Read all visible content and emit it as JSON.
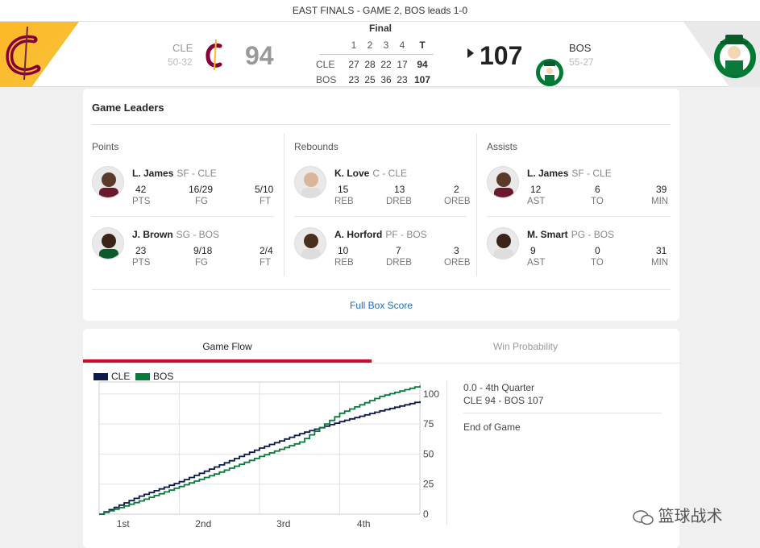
{
  "series_text": "EAST FINALS - GAME 2, BOS leads 1-0",
  "away": {
    "abbr": "CLE",
    "record": "50-32",
    "score": "94",
    "color": "#860038"
  },
  "home": {
    "abbr": "BOS",
    "record": "55-27",
    "score": "107",
    "color": "#007a33"
  },
  "linescore": {
    "status": "Final",
    "headers": [
      "1",
      "2",
      "3",
      "4",
      "T"
    ],
    "rows": [
      {
        "team": "CLE",
        "q": [
          "27",
          "28",
          "22",
          "17"
        ],
        "total": "94"
      },
      {
        "team": "BOS",
        "q": [
          "23",
          "25",
          "36",
          "23"
        ],
        "total": "107"
      }
    ]
  },
  "leaders": {
    "title": "Game Leaders",
    "columns": [
      {
        "title": "Points",
        "players": [
          {
            "name": "L. James",
            "pos": "SF - CLE",
            "stats": [
              "42",
              "16/29",
              "5/10"
            ],
            "labels": [
              "PTS",
              "FG",
              "FT"
            ]
          },
          {
            "name": "J. Brown",
            "pos": "SG - BOS",
            "stats": [
              "23",
              "9/18",
              "2/4"
            ],
            "labels": [
              "PTS",
              "FG",
              "FT"
            ]
          }
        ]
      },
      {
        "title": "Rebounds",
        "players": [
          {
            "name": "K. Love",
            "pos": "C - CLE",
            "stats": [
              "15",
              "13",
              "2"
            ],
            "labels": [
              "REB",
              "DREB",
              "OREB"
            ]
          },
          {
            "name": "A. Horford",
            "pos": "PF - BOS",
            "stats": [
              "10",
              "7",
              "3"
            ],
            "labels": [
              "REB",
              "DREB",
              "OREB"
            ]
          }
        ]
      },
      {
        "title": "Assists",
        "players": [
          {
            "name": "L. James",
            "pos": "SF - CLE",
            "stats": [
              "12",
              "6",
              "39"
            ],
            "labels": [
              "AST",
              "TO",
              "MIN"
            ]
          },
          {
            "name": "M. Smart",
            "pos": "PG - BOS",
            "stats": [
              "9",
              "0",
              "31"
            ],
            "labels": [
              "AST",
              "TO",
              "MIN"
            ]
          }
        ]
      }
    ],
    "full_box_label": "Full Box Score"
  },
  "flow": {
    "tabs": [
      {
        "label": "Game Flow",
        "active": true
      },
      {
        "label": "Win Probability",
        "active": false
      }
    ],
    "side_time": "0.0 - 4th Quarter",
    "side_score": "CLE 94  - BOS 107",
    "side_status": "End of Game"
  },
  "watermark": "篮球战术",
  "chart_data": {
    "type": "line",
    "x": [
      0,
      6,
      12,
      18,
      24,
      30,
      36,
      42,
      48
    ],
    "xlabel": "",
    "ylabel": "",
    "x_tick_labels": [
      "1st",
      "2nd",
      "3rd",
      "4th"
    ],
    "y_ticks": [
      0,
      25,
      50,
      75,
      100
    ],
    "ylim": [
      0,
      110
    ],
    "xlim": [
      0,
      48
    ],
    "grid": true,
    "legend": "top-left",
    "series": [
      {
        "name": "CLE",
        "color": "#0b1a48",
        "values": [
          0,
          15,
          27,
          41,
          55,
          67,
          77,
          86,
          94
        ]
      },
      {
        "name": "BOS",
        "color": "#0a7a3a",
        "values": [
          0,
          11,
          23,
          35,
          48,
          60,
          84,
          98,
          107
        ]
      }
    ]
  }
}
